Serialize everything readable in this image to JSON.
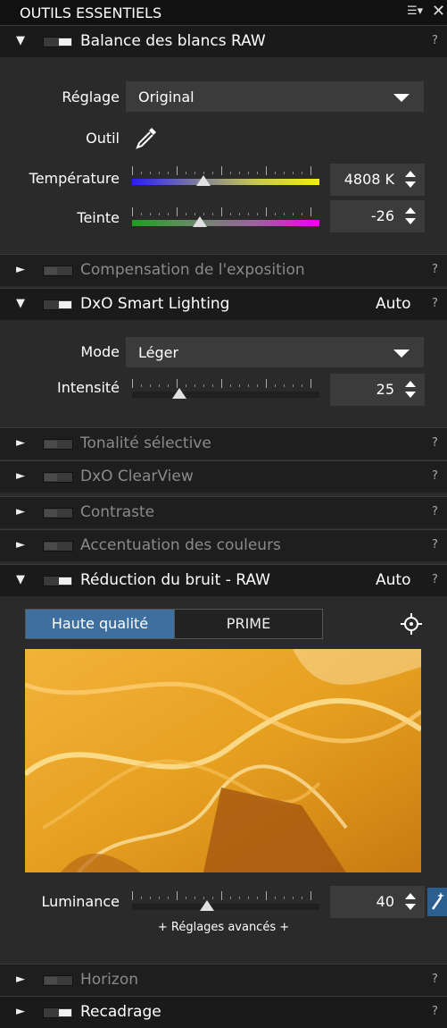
{
  "panel": {
    "title": "OUTILS ESSENTIELS"
  },
  "white_balance": {
    "header": "Balance des blancs RAW",
    "reglage_label": "Réglage",
    "reglage_value": "Original",
    "outil_label": "Outil",
    "temperature_label": "Température",
    "temperature_value": "4808 K",
    "temperature_position": 0.38,
    "teinte_label": "Teinte",
    "teinte_value": "-26",
    "teinte_position": 0.36
  },
  "exposure": {
    "header": "Compensation de l'exposition"
  },
  "smart_lighting": {
    "header": "DxO Smart Lighting",
    "auto": "Auto",
    "mode_label": "Mode",
    "mode_value": "Léger",
    "intensite_label": "Intensité",
    "intensite_value": "25",
    "intensite_position": 0.25
  },
  "tonalite": {
    "header": "Tonalité sélective"
  },
  "clearview": {
    "header": "DxO ClearView"
  },
  "contraste": {
    "header": "Contraste"
  },
  "accentuation": {
    "header": "Accentuation des couleurs"
  },
  "noise": {
    "header": "Réduction du bruit - RAW",
    "auto": "Auto",
    "tab_hq": "Haute qualité",
    "tab_prime": "PRIME",
    "luminance_label": "Luminance",
    "luminance_value": "40",
    "luminance_position": 0.4,
    "advanced": "+ Réglages avancés +"
  },
  "horizon": {
    "header": "Horizon"
  },
  "recadrage": {
    "header": "Recadrage"
  },
  "help": "?",
  "colors": {
    "accent": "#3f6f9f",
    "background": "#2a2a2a",
    "header_bg": "#1a1a1a"
  }
}
